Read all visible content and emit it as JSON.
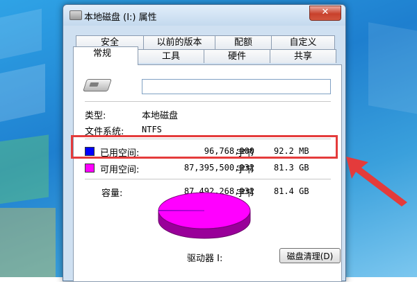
{
  "window": {
    "title": "本地磁盘 (I:) 属性",
    "close_label": "✕"
  },
  "tabs": {
    "row1": [
      "安全",
      "以前的版本",
      "配额",
      "自定义"
    ],
    "row2": [
      "工具",
      "硬件",
      "共享"
    ],
    "active": "常规"
  },
  "general": {
    "name_value": "",
    "type_label": "类型:",
    "type_value": "本地磁盘",
    "fs_label": "文件系统:",
    "fs_value": "NTFS",
    "used_label": "已用空间:",
    "used_bytes": "96,768,000",
    "used_unit": "字节",
    "used_size": "92.2 MB",
    "free_label": "可用空间:",
    "free_bytes": "87,395,500,032",
    "free_unit": "字节",
    "free_size": "81.3 GB",
    "capacity_label": "容量:",
    "capacity_bytes": "87,492,268,032",
    "capacity_unit": "字节",
    "capacity_size": "81.4 GB",
    "drive_label": "驱动器 I:",
    "cleanup_label": "磁盘清理(D)"
  },
  "colors": {
    "used": "#0000ff",
    "free": "#ff00ff",
    "highlight": "#e43b3b"
  },
  "chart_data": {
    "type": "pie",
    "categories": [
      "已用空间",
      "可用空间"
    ],
    "values": [
      96768000,
      87395500032
    ]
  }
}
